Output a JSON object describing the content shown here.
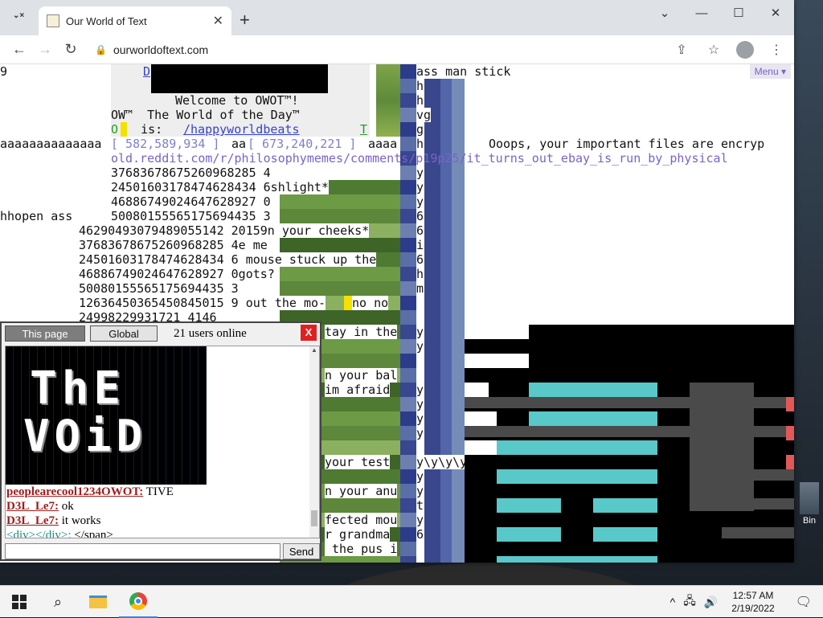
{
  "browser": {
    "tab_title": "Our World of Text",
    "tab_search": "⌄×",
    "new_tab": "+",
    "url": "ourworldoftext.com",
    "win_min": "⌄",
    "win_min2": "—",
    "win_max": "☐",
    "win_close": "✕"
  },
  "page": {
    "menu": "Menu ▾",
    "lines": {
      "l0": "9",
      "l0b": "D",
      "l1": "Welcome to OWOT™!",
      "l2": "OW™  The World of the Day™",
      "l3a": "O",
      "l3b": "   is: ",
      "l3c": "/happyworldbeats",
      "l3d": "T",
      "l4": "aaaaaaaaaaaaaa",
      "l4b": "[ 582,589,934 ]",
      "l4c": "aa",
      "l4d": "[ 673,240,221 ]",
      "l4e": "aaaa",
      "l5": "old.reddit.com/r/philosophymemes/comments/p19p25/it_turns_out_ebay_is_run_by_physical",
      "l6": "37683678675260968285 4",
      "l7": "24501603178474628434 6shlight*",
      "l8": "46886749024647628927 0",
      "l9a": "hhopen ass",
      "l9b": "50080155565175694435 3",
      "l10": "46290493079489055142 20159n your cheeks*",
      "l11": "37683678675260968285 4e me",
      "l12": "24501603178474628434 6 mouse stuck up the",
      "l13": "46886749024647628927 0gots?",
      "l14": "50080155565175694435 3",
      "l15a": "12636450365450845015 9 out the mo-",
      "l15b": "no no",
      "l16": "24998229931721 4146",
      "r0": "ass man stick",
      "r1": "Ooops, your important files are encryp",
      "rcol": [
        "h",
        "h",
        "vg",
        "g",
        "h",
        "",
        "y",
        "y",
        "y",
        "6",
        "6",
        "i",
        "6",
        "h",
        "m",
        "",
        "",
        "y",
        "y",
        "",
        "",
        "y",
        "y",
        "y",
        "y",
        "",
        "y\\y\\y\\y",
        "y",
        "y",
        "t",
        "y",
        "6"
      ],
      "mid": [
        "tay in the",
        "",
        "",
        "n your bal",
        "im afraid",
        "",
        "",
        "",
        "",
        "your test",
        "",
        "n your anu",
        "",
        "fected mou",
        "r grandma",
        " the pus i"
      ]
    }
  },
  "chat": {
    "tab_this": "This page",
    "tab_global": "Global",
    "users_online": "21 users online",
    "close": "X",
    "void_line1": "ThE",
    "void_line2": "VOiD",
    "messages": [
      {
        "user": "peoplearecool1234OWOT:",
        "text": " TIVE"
      },
      {
        "user": "D3L_Le7:",
        "text": " ok"
      },
      {
        "user": "D3L_Le7:",
        "text": " it works"
      },
      {
        "user": "<div></div>:",
        "text": " </span>"
      }
    ],
    "send": "Send",
    "scroll_up": "▲"
  },
  "desktop": {
    "recycle_label": "Bin"
  },
  "taskbar": {
    "search_glyph": "⌕",
    "tray_up": "^",
    "tray_net": "🖧",
    "tray_vol": "🔊",
    "time": "12:57 AM",
    "date": "2/19/2022",
    "notif": "🗨"
  }
}
